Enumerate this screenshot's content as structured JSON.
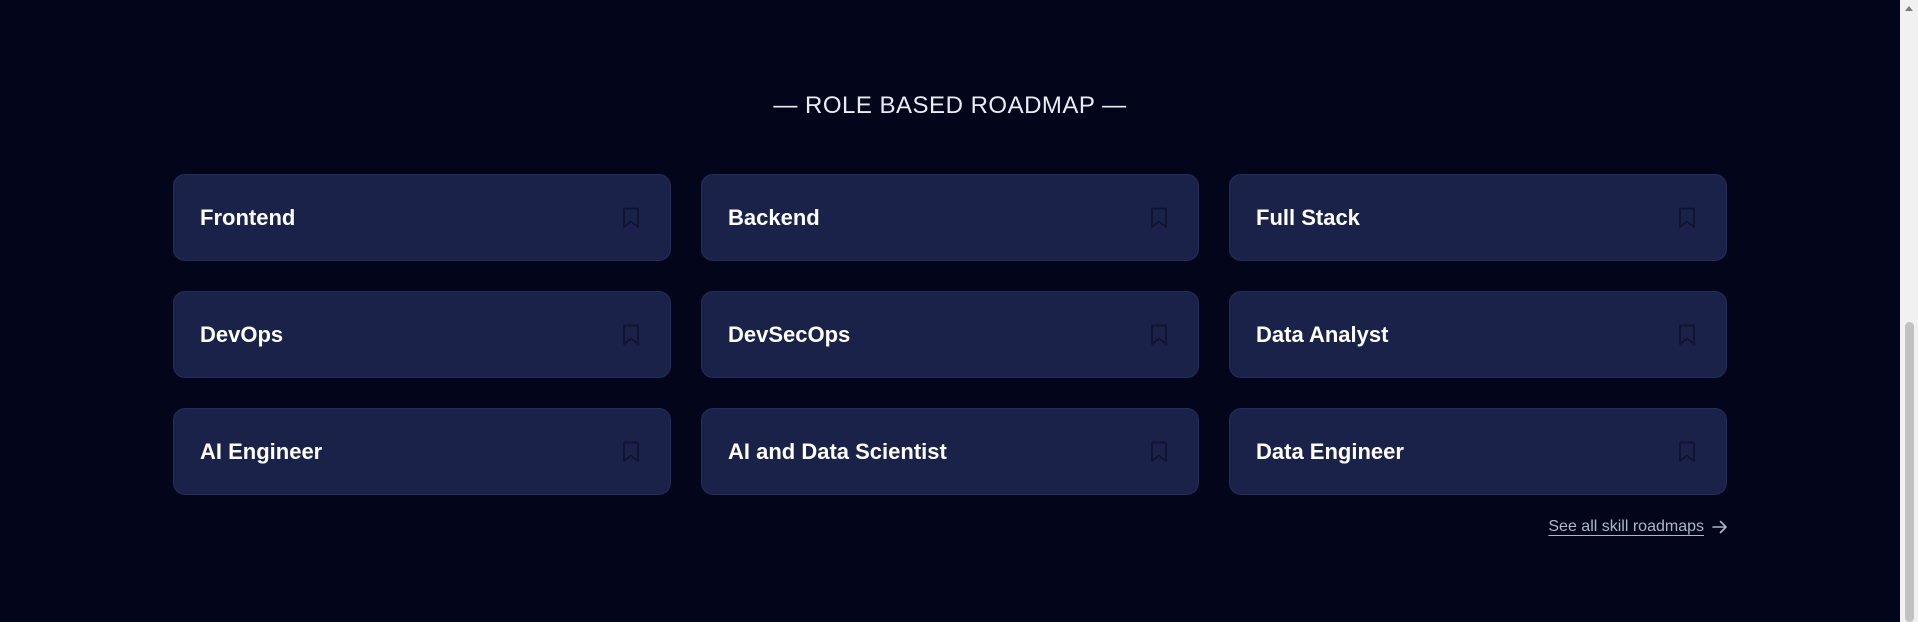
{
  "section": {
    "title": "— ROLE BASED ROADMAP —"
  },
  "roadmaps": [
    {
      "label": "Frontend",
      "icon": "bookmark-icon"
    },
    {
      "label": "Backend",
      "icon": "bookmark-icon"
    },
    {
      "label": "Full Stack",
      "icon": "bookmark-icon"
    },
    {
      "label": "DevOps",
      "icon": "bookmark-icon"
    },
    {
      "label": "DevSecOps",
      "icon": "bookmark-icon"
    },
    {
      "label": "Data Analyst",
      "icon": "bookmark-icon"
    },
    {
      "label": "AI Engineer",
      "icon": "bookmark-icon"
    },
    {
      "label": "AI and Data Scientist",
      "icon": "bookmark-icon"
    },
    {
      "label": "Data Engineer",
      "icon": "bookmark-icon"
    }
  ],
  "see_all": {
    "label": "See all skill roadmaps",
    "icon": "arrow-right-icon"
  },
  "colors": {
    "background": "#03061a",
    "card": "#1b2249",
    "text": "#ffffff",
    "muted": "#aeb5cc"
  }
}
